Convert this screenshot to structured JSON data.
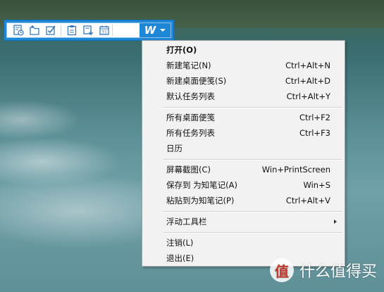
{
  "toolbar": {
    "buttons": [
      {
        "icon": "note-clock-icon"
      },
      {
        "icon": "folder-pin-icon"
      },
      {
        "icon": "checkbox-icon"
      },
      {
        "icon": "clipboard-icon"
      },
      {
        "icon": "note-add-icon"
      },
      {
        "icon": "calendar-icon"
      }
    ],
    "app_label": "W",
    "accent_color": "#1e88d7"
  },
  "menu": {
    "items": [
      {
        "label": "打开(O)",
        "shortcut": "",
        "bold": true
      },
      {
        "label": "新建笔记(N)",
        "shortcut": "Ctrl+Alt+N"
      },
      {
        "label": "新建桌面便笺(S)",
        "shortcut": "Ctrl+Alt+D"
      },
      {
        "label": "默认任务列表",
        "shortcut": "Ctrl+Alt+Y"
      },
      {
        "label": "所有桌面便笺",
        "shortcut": "Ctrl+F2"
      },
      {
        "label": "所有任务列表",
        "shortcut": "Ctrl+F3"
      },
      {
        "label": "日历",
        "shortcut": ""
      },
      {
        "label": "屏幕截图(C)",
        "shortcut": "Win+PrintScreen"
      },
      {
        "label": "保存到 为知笔记(A)",
        "shortcut": "Win+S"
      },
      {
        "label": "粘贴到为知笔记(P)",
        "shortcut": "Ctrl+Alt+V"
      },
      {
        "label": "浮动工具栏",
        "shortcut": "",
        "submenu": true
      },
      {
        "label": "注销(L)",
        "shortcut": ""
      },
      {
        "label": "退出(E)",
        "shortcut": ""
      }
    ]
  },
  "watermark": {
    "logo_text": "值",
    "text": "什么值得买"
  }
}
